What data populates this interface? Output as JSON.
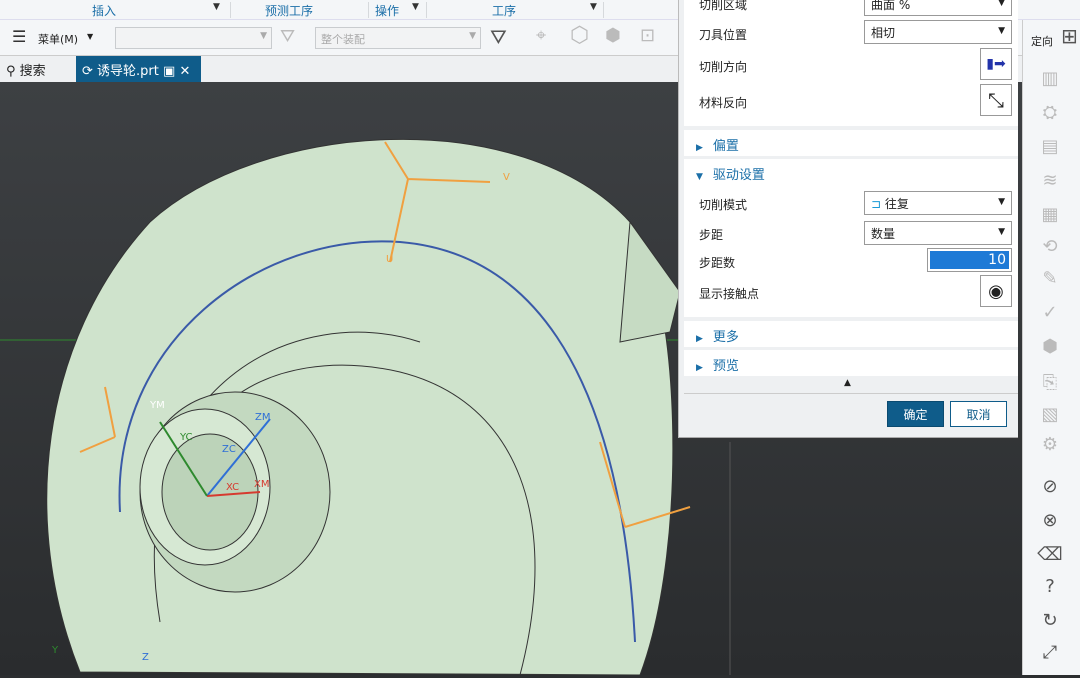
{
  "ribbon": {
    "groups": [
      "插入",
      "预测工序",
      "操作",
      "工序"
    ]
  },
  "toolbar": {
    "menu_label": "菜单(M)",
    "filter_value": "",
    "scope_value": "整个装配"
  },
  "tabs": [
    {
      "label": "搜索"
    },
    {
      "label": "诱导轮.prt"
    }
  ],
  "orient_label": "定向",
  "dialog": {
    "rows_top": [
      {
        "label": "切削区域",
        "value": "曲面 %"
      },
      {
        "label": "刀具位置",
        "value": "相切"
      }
    ],
    "cut_direction_label": "切削方向",
    "material_reverse_label": "材料反向",
    "sections": {
      "offset": "偏置",
      "drive": "驱动设置",
      "more": "更多",
      "preview": "预览"
    },
    "cut_mode": {
      "label": "切削模式",
      "value": "往复"
    },
    "stepover": {
      "label": "步距",
      "value": "数量"
    },
    "step_count": {
      "label": "步距数",
      "value": "10"
    },
    "show_contact_label": "显示接触点",
    "ok_label": "确定",
    "cancel_label": "取消"
  },
  "viewport": {
    "axis_labels": {
      "ym": "YM",
      "zm": "ZM",
      "zc": "ZC",
      "xc": "XC",
      "xm": "XM",
      "yc": "YC",
      "v": "V",
      "u": "U",
      "y": "Y",
      "z": "Z"
    }
  },
  "colors": {
    "accent": "#1b6fa8",
    "part": "#cfe3cc",
    "selection": "#1e7ad6"
  }
}
